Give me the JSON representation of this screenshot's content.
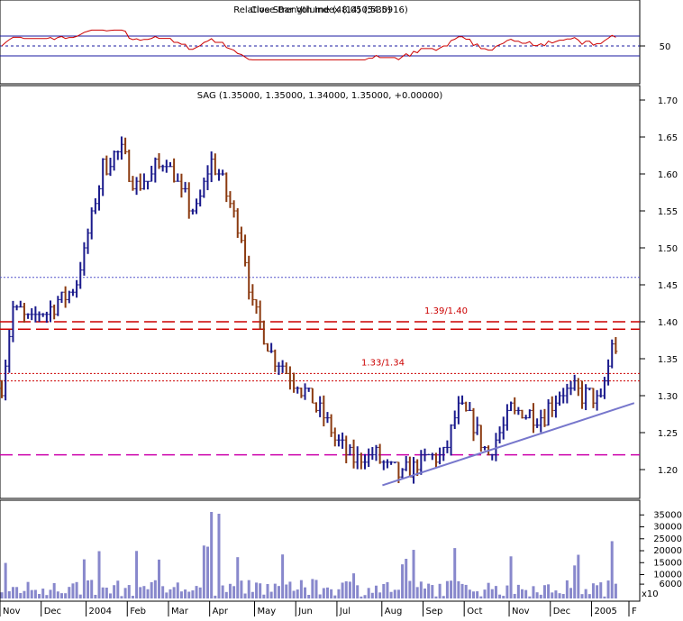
{
  "chart_data": [
    {
      "type": "line",
      "panel": "rsi",
      "title": "Relative Strength Index (14) (54.5916)",
      "title_overprint": "Close Bar Volume (48,050,530)",
      "ylim": [
        0,
        100
      ],
      "yticks": [
        50
      ],
      "reference_lines": [
        70,
        50,
        30
      ],
      "color": "#cc0000"
    },
    {
      "type": "ohlc",
      "panel": "price",
      "title": "SAG (1.35000, 1.35000, 1.34000, 1.35000, +0.00000)",
      "ylim": [
        1.16,
        1.72
      ],
      "yticks": [
        "1.70",
        "1.65",
        "1.60",
        "1.55",
        "1.50",
        "1.45",
        "1.40",
        "1.35",
        "1.30",
        "1.25",
        "1.20"
      ],
      "x_labels": [
        "Nov",
        "Dec",
        "2004",
        "Feb",
        "Mar",
        "Apr",
        "May",
        "Jun",
        "Jul",
        "Aug",
        "Sep",
        "Oct",
        "Nov",
        "Dec",
        "2005",
        "F"
      ],
      "trend_points": [
        {
          "t": 0,
          "p": 1.31
        },
        {
          "t": 3,
          "p": 1.42
        },
        {
          "t": 7,
          "p": 1.4
        },
        {
          "t": 14,
          "p": 1.42
        },
        {
          "t": 20,
          "p": 1.45
        },
        {
          "t": 27,
          "p": 1.61
        },
        {
          "t": 32,
          "p": 1.63
        },
        {
          "t": 36,
          "p": 1.58
        },
        {
          "t": 44,
          "p": 1.62
        },
        {
          "t": 48,
          "p": 1.57
        },
        {
          "t": 52,
          "p": 1.55
        },
        {
          "t": 56,
          "p": 1.62
        },
        {
          "t": 58,
          "p": 1.6
        },
        {
          "t": 64,
          "p": 1.52
        },
        {
          "t": 67,
          "p": 1.42
        },
        {
          "t": 72,
          "p": 1.36
        },
        {
          "t": 76,
          "p": 1.33
        },
        {
          "t": 82,
          "p": 1.3
        },
        {
          "t": 88,
          "p": 1.25
        },
        {
          "t": 94,
          "p": 1.21
        },
        {
          "t": 100,
          "p": 1.22
        },
        {
          "t": 106,
          "p": 1.19
        },
        {
          "t": 112,
          "p": 1.21
        },
        {
          "t": 118,
          "p": 1.22
        },
        {
          "t": 122,
          "p": 1.28
        },
        {
          "t": 126,
          "p": 1.26
        },
        {
          "t": 130,
          "p": 1.22
        },
        {
          "t": 136,
          "p": 1.28
        },
        {
          "t": 144,
          "p": 1.27
        },
        {
          "t": 150,
          "p": 1.31
        },
        {
          "t": 156,
          "p": 1.3
        },
        {
          "t": 160,
          "p": 1.29
        },
        {
          "t": 163,
          "p": 1.37
        },
        {
          "t": 164,
          "p": 1.35
        }
      ],
      "horizontal_levels": [
        {
          "price": 1.46,
          "style": "dotted",
          "color": "#5555cc"
        },
        {
          "price": 1.4,
          "style": "dashed",
          "color": "#cc0000",
          "label": "1.39/1.40"
        },
        {
          "price": 1.39,
          "style": "dashed",
          "color": "#cc0000"
        },
        {
          "price": 1.33,
          "style": "dotted",
          "color": "#cc0000",
          "label": "1.33/1.34"
        },
        {
          "price": 1.32,
          "style": "dotted",
          "color": "#cc0000"
        },
        {
          "price": 1.22,
          "style": "dashed",
          "color": "#cc00aa"
        }
      ],
      "trendline": {
        "from": {
          "t": 106,
          "p": 1.18
        },
        "to": {
          "t": 167,
          "p": 1.29
        },
        "color": "#7777cc"
      },
      "up_color": "#1a1a8c",
      "down_color": "#8b3a10"
    },
    {
      "type": "bar",
      "panel": "volume",
      "yticks": [
        "35000",
        "30000",
        "25000",
        "20000",
        "15000",
        "10000",
        "6000"
      ],
      "multiplier_label": "x10",
      "color": "#8888cc"
    }
  ]
}
